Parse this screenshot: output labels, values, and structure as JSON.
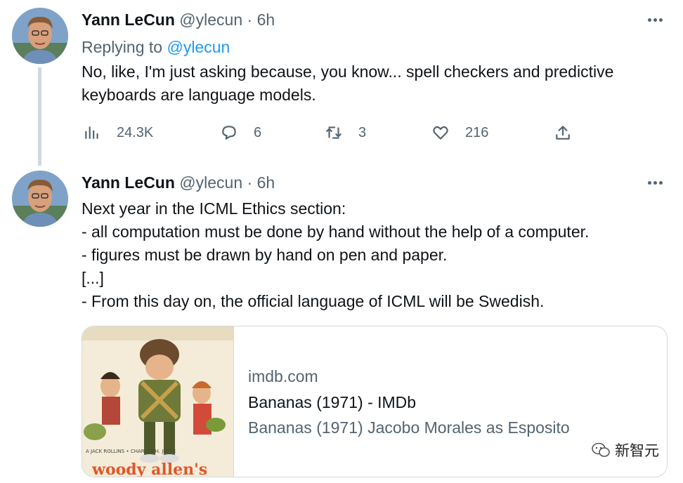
{
  "tweets": [
    {
      "author_name": "Yann LeCun",
      "handle": "@ylecun",
      "separator": "·",
      "time": "6h",
      "replying_label": "Replying to",
      "replying_to": "@ylecun",
      "text_lines": [
        "No, like, I'm just asking because, you know... spell checkers and predictive",
        "keyboards are language models."
      ],
      "stats": {
        "views": "24.3K",
        "replies": "6",
        "retweets": "3",
        "likes": "216"
      }
    },
    {
      "author_name": "Yann LeCun",
      "handle": "@ylecun",
      "separator": "·",
      "time": "6h",
      "text_lines": [
        "Next year in the ICML Ethics section:",
        "- all computation must be done by hand without the help of a computer.",
        "- figures must be drawn by hand on pen and paper.",
        "[...]",
        "- From this day on, the official language of ICML will be Swedish."
      ],
      "card": {
        "domain": "imdb.com",
        "title": "Bananas (1971) - IMDb",
        "description": "Bananas (1971) Jacobo Morales as Esposito",
        "poster_text": "woody allen's"
      }
    }
  ],
  "watermark": {
    "text": "新智元"
  },
  "colors": {
    "accent": "#1d9bf0",
    "secondary": "#536471",
    "border": "#cfd9de"
  }
}
